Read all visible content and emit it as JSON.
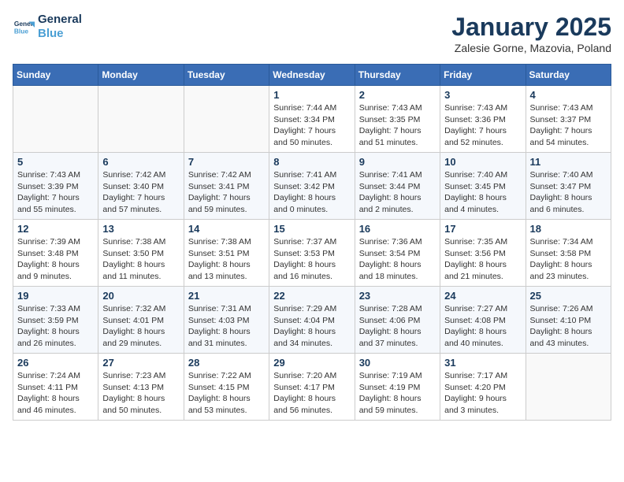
{
  "logo": {
    "line1": "General",
    "line2": "Blue"
  },
  "title": "January 2025",
  "subtitle": "Zalesie Gorne, Mazovia, Poland",
  "weekdays": [
    "Sunday",
    "Monday",
    "Tuesday",
    "Wednesday",
    "Thursday",
    "Friday",
    "Saturday"
  ],
  "weeks": [
    [
      {
        "day": "",
        "info": ""
      },
      {
        "day": "",
        "info": ""
      },
      {
        "day": "",
        "info": ""
      },
      {
        "day": "1",
        "info": "Sunrise: 7:44 AM\nSunset: 3:34 PM\nDaylight: 7 hours\nand 50 minutes."
      },
      {
        "day": "2",
        "info": "Sunrise: 7:43 AM\nSunset: 3:35 PM\nDaylight: 7 hours\nand 51 minutes."
      },
      {
        "day": "3",
        "info": "Sunrise: 7:43 AM\nSunset: 3:36 PM\nDaylight: 7 hours\nand 52 minutes."
      },
      {
        "day": "4",
        "info": "Sunrise: 7:43 AM\nSunset: 3:37 PM\nDaylight: 7 hours\nand 54 minutes."
      }
    ],
    [
      {
        "day": "5",
        "info": "Sunrise: 7:43 AM\nSunset: 3:39 PM\nDaylight: 7 hours\nand 55 minutes."
      },
      {
        "day": "6",
        "info": "Sunrise: 7:42 AM\nSunset: 3:40 PM\nDaylight: 7 hours\nand 57 minutes."
      },
      {
        "day": "7",
        "info": "Sunrise: 7:42 AM\nSunset: 3:41 PM\nDaylight: 7 hours\nand 59 minutes."
      },
      {
        "day": "8",
        "info": "Sunrise: 7:41 AM\nSunset: 3:42 PM\nDaylight: 8 hours\nand 0 minutes."
      },
      {
        "day": "9",
        "info": "Sunrise: 7:41 AM\nSunset: 3:44 PM\nDaylight: 8 hours\nand 2 minutes."
      },
      {
        "day": "10",
        "info": "Sunrise: 7:40 AM\nSunset: 3:45 PM\nDaylight: 8 hours\nand 4 minutes."
      },
      {
        "day": "11",
        "info": "Sunrise: 7:40 AM\nSunset: 3:47 PM\nDaylight: 8 hours\nand 6 minutes."
      }
    ],
    [
      {
        "day": "12",
        "info": "Sunrise: 7:39 AM\nSunset: 3:48 PM\nDaylight: 8 hours\nand 9 minutes."
      },
      {
        "day": "13",
        "info": "Sunrise: 7:38 AM\nSunset: 3:50 PM\nDaylight: 8 hours\nand 11 minutes."
      },
      {
        "day": "14",
        "info": "Sunrise: 7:38 AM\nSunset: 3:51 PM\nDaylight: 8 hours\nand 13 minutes."
      },
      {
        "day": "15",
        "info": "Sunrise: 7:37 AM\nSunset: 3:53 PM\nDaylight: 8 hours\nand 16 minutes."
      },
      {
        "day": "16",
        "info": "Sunrise: 7:36 AM\nSunset: 3:54 PM\nDaylight: 8 hours\nand 18 minutes."
      },
      {
        "day": "17",
        "info": "Sunrise: 7:35 AM\nSunset: 3:56 PM\nDaylight: 8 hours\nand 21 minutes."
      },
      {
        "day": "18",
        "info": "Sunrise: 7:34 AM\nSunset: 3:58 PM\nDaylight: 8 hours\nand 23 minutes."
      }
    ],
    [
      {
        "day": "19",
        "info": "Sunrise: 7:33 AM\nSunset: 3:59 PM\nDaylight: 8 hours\nand 26 minutes."
      },
      {
        "day": "20",
        "info": "Sunrise: 7:32 AM\nSunset: 4:01 PM\nDaylight: 8 hours\nand 29 minutes."
      },
      {
        "day": "21",
        "info": "Sunrise: 7:31 AM\nSunset: 4:03 PM\nDaylight: 8 hours\nand 31 minutes."
      },
      {
        "day": "22",
        "info": "Sunrise: 7:29 AM\nSunset: 4:04 PM\nDaylight: 8 hours\nand 34 minutes."
      },
      {
        "day": "23",
        "info": "Sunrise: 7:28 AM\nSunset: 4:06 PM\nDaylight: 8 hours\nand 37 minutes."
      },
      {
        "day": "24",
        "info": "Sunrise: 7:27 AM\nSunset: 4:08 PM\nDaylight: 8 hours\nand 40 minutes."
      },
      {
        "day": "25",
        "info": "Sunrise: 7:26 AM\nSunset: 4:10 PM\nDaylight: 8 hours\nand 43 minutes."
      }
    ],
    [
      {
        "day": "26",
        "info": "Sunrise: 7:24 AM\nSunset: 4:11 PM\nDaylight: 8 hours\nand 46 minutes."
      },
      {
        "day": "27",
        "info": "Sunrise: 7:23 AM\nSunset: 4:13 PM\nDaylight: 8 hours\nand 50 minutes."
      },
      {
        "day": "28",
        "info": "Sunrise: 7:22 AM\nSunset: 4:15 PM\nDaylight: 8 hours\nand 53 minutes."
      },
      {
        "day": "29",
        "info": "Sunrise: 7:20 AM\nSunset: 4:17 PM\nDaylight: 8 hours\nand 56 minutes."
      },
      {
        "day": "30",
        "info": "Sunrise: 7:19 AM\nSunset: 4:19 PM\nDaylight: 8 hours\nand 59 minutes."
      },
      {
        "day": "31",
        "info": "Sunrise: 7:17 AM\nSunset: 4:20 PM\nDaylight: 9 hours\nand 3 minutes."
      },
      {
        "day": "",
        "info": ""
      }
    ]
  ]
}
